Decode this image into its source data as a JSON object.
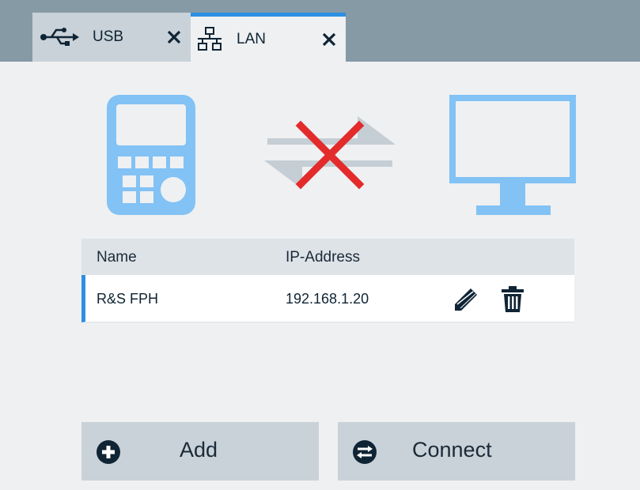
{
  "tabs": [
    {
      "label": "USB",
      "icon": "usb-icon",
      "close_icon": "close-icon",
      "active": false
    },
    {
      "label": "LAN",
      "icon": "network-icon",
      "close_icon": "close-icon",
      "active": true
    }
  ],
  "status": {
    "device_icon": "handheld-device-icon",
    "link_icon": "disconnected-icon",
    "pc_icon": "monitor-icon"
  },
  "table": {
    "headers": {
      "name": "Name",
      "ip": "IP-Address"
    },
    "rows": [
      {
        "name": "R&S FPH",
        "ip": "192.168.1.20",
        "edit_icon": "pencil-icon",
        "delete_icon": "trash-icon"
      }
    ]
  },
  "buttons": {
    "add": {
      "label": "Add",
      "icon": "plus-circle-icon"
    },
    "connect": {
      "label": "Connect",
      "icon": "swap-circle-icon"
    }
  },
  "colors": {
    "accent": "#2c8fe3",
    "device_blue": "#82c2f5",
    "error_red": "#e32b2b",
    "tabbar": "#869aa6",
    "button_bg": "#c9d2d8"
  }
}
